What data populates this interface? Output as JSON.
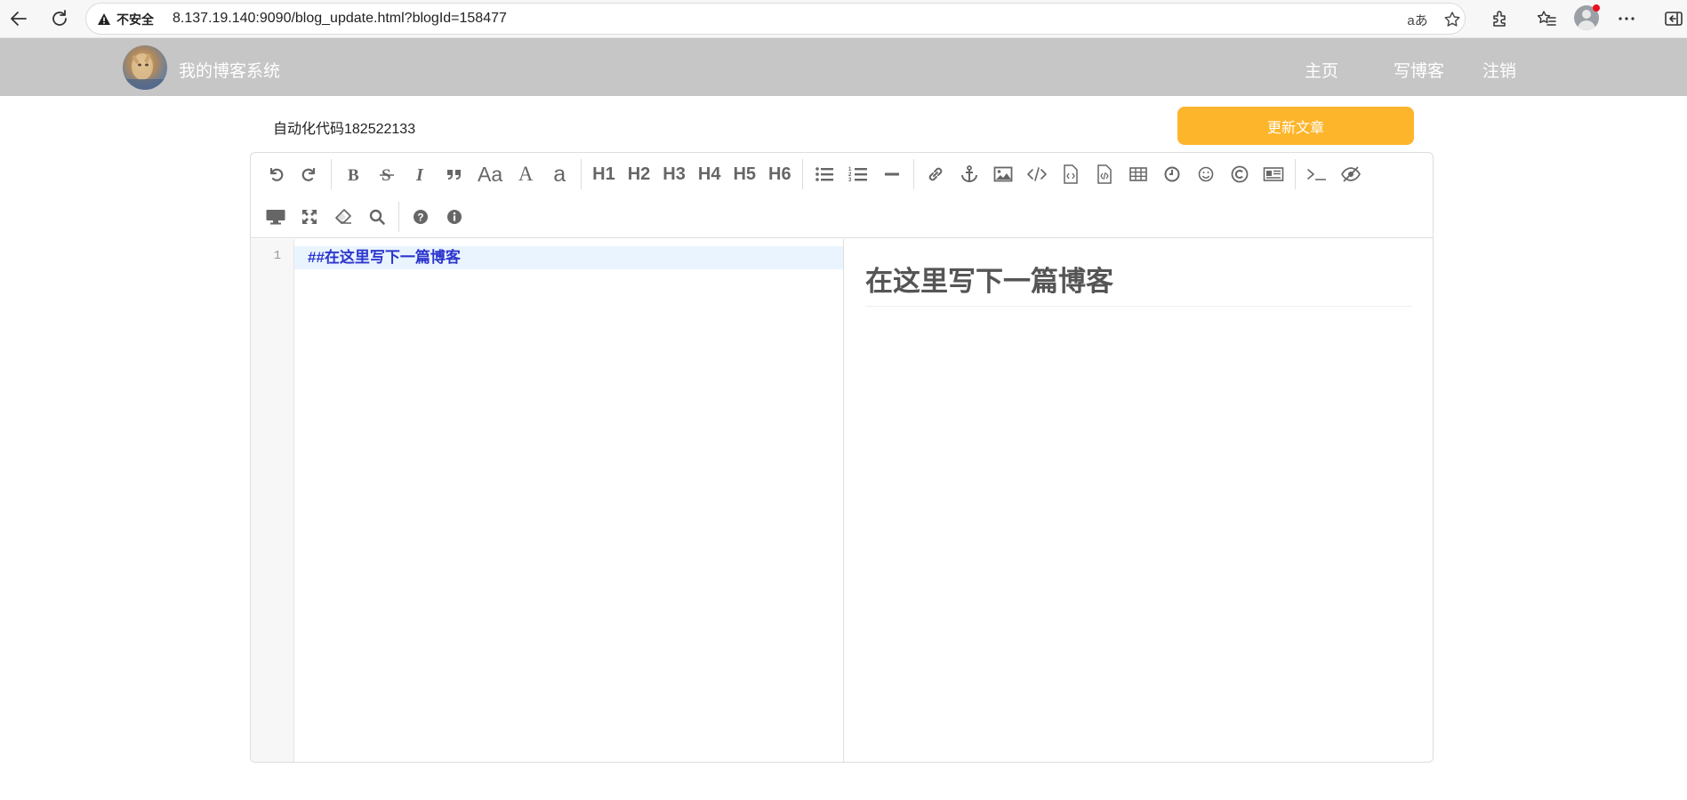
{
  "browser": {
    "security_label": "不安全",
    "url": "8.137.19.140:9090/blog_update.html?blogId=158477",
    "read_aloud_label": "aあ"
  },
  "nav": {
    "site_title": "我的博客系统",
    "links": {
      "home": "主页",
      "write": "写博客",
      "logout": "注销"
    }
  },
  "editor_page": {
    "title_value": "自动化代码182522133",
    "update_button": "更新文章"
  },
  "toolbar": {
    "aa_label": "Aa",
    "a_upper": "A",
    "a_lower": "a",
    "headings": [
      "H1",
      "H2",
      "H3",
      "H4",
      "H5",
      "H6"
    ]
  },
  "markdown": {
    "line_number": "1",
    "line_text": "##在这里写下一篇博客"
  },
  "preview": {
    "heading": "在这里写下一篇博客"
  },
  "colors": {
    "navbar_bg": "#c6c6c6",
    "update_button_bg": "#fdb52b",
    "code_text": "#2c36ce",
    "active_line_bg": "#eaf4fe"
  }
}
